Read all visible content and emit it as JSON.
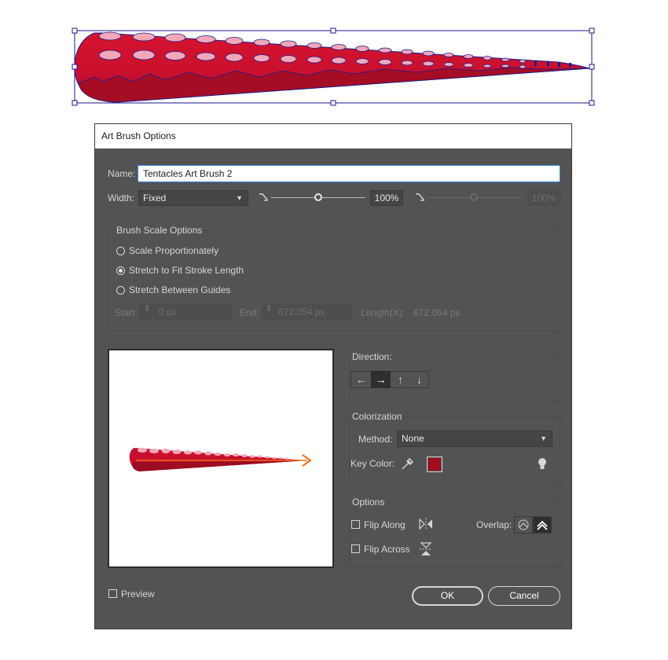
{
  "dialog": {
    "title": "Art Brush Options",
    "name_label": "Name:",
    "name_value": "Tentacles Art Brush 2",
    "width_label": "Width:",
    "width_option": "Fixed",
    "width_percent": "100%",
    "width_percent_disabled": "100%",
    "scale_group": {
      "title": "Brush Scale Options",
      "options": [
        "Scale Proportionately",
        "Stretch to Fit Stroke Length",
        "Stretch Between Guides"
      ],
      "selected_index": 1,
      "start_label": "Start:",
      "start_value": "0 px",
      "end_label": "End:",
      "end_value": "672.054 px",
      "length_label": "Length(X):",
      "length_value": "672.054 px"
    },
    "direction": {
      "title": "Direction:",
      "buttons": [
        "←",
        "→",
        "↑",
        "↓"
      ],
      "selected_index": 1
    },
    "colorization": {
      "title": "Colorization",
      "method_label": "Method:",
      "method_value": "None",
      "key_color_label": "Key Color:",
      "key_color": "#a0101f"
    },
    "options": {
      "title": "Options",
      "flip_along": "Flip Along",
      "flip_across": "Flip Across",
      "overlap_label": "Overlap:"
    },
    "preview_label": "Preview",
    "ok_label": "OK",
    "cancel_label": "Cancel"
  },
  "colors": {
    "dialog_bg": "#535353",
    "tentacle_red": "#c8102e",
    "sucker_pink": "#f3a7b8",
    "selection_blue": "#1a1a8c",
    "arrow_orange": "#f26a1b"
  }
}
